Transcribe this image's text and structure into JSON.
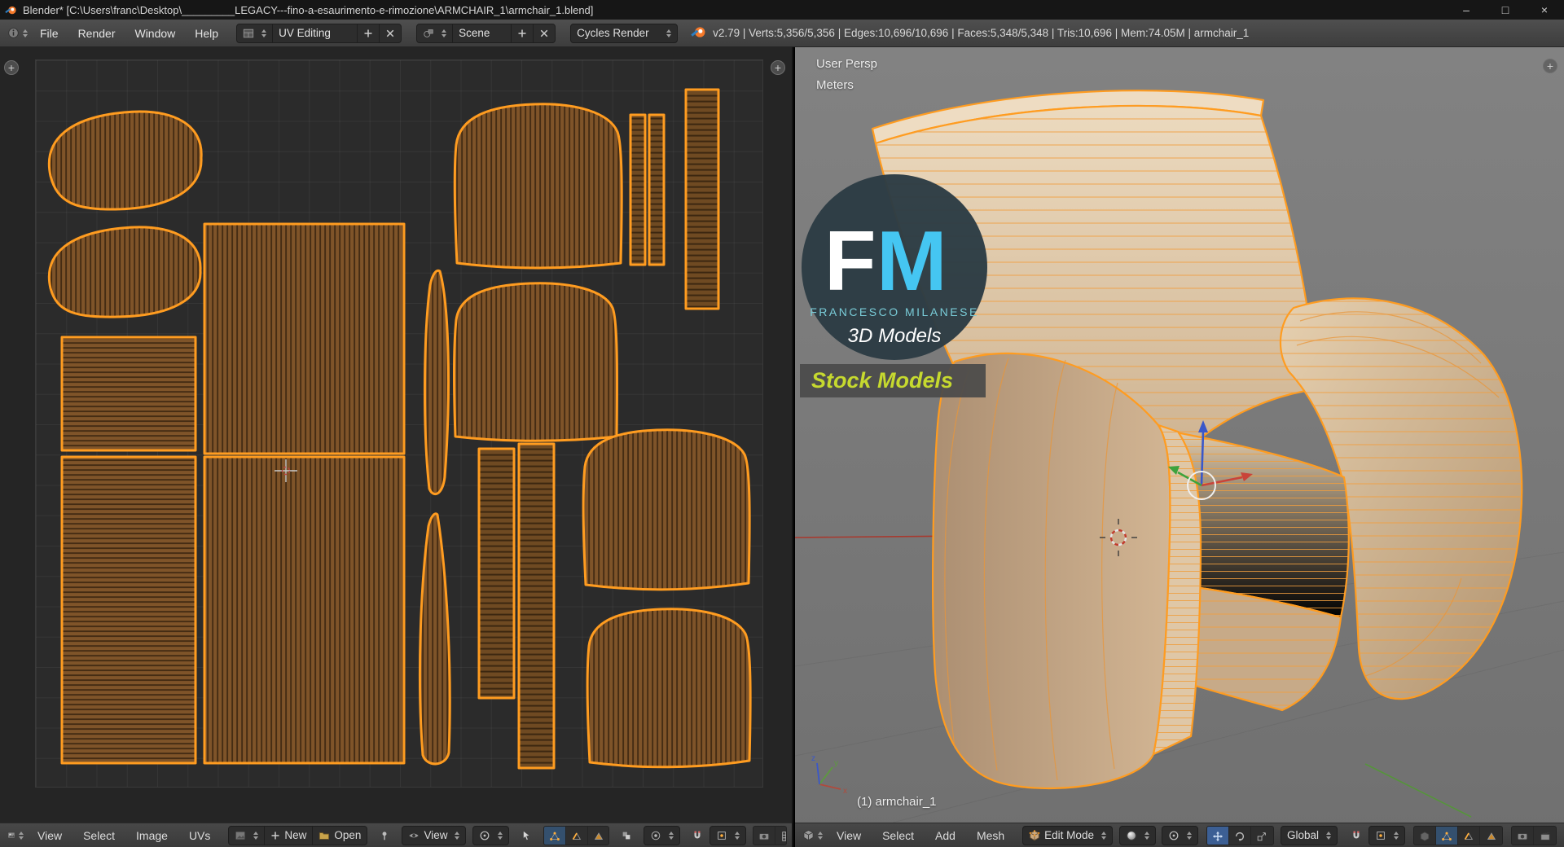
{
  "colors": {
    "selection_orange": "#ff9c20",
    "uv_island_fill": "#7f5429",
    "watermark_blue": "#45c6f2",
    "stock_green": "#c6d92f"
  },
  "icons": {
    "minimize": "–",
    "maximize": "□",
    "close": "×"
  },
  "titlebar": {
    "title": "Blender* [C:\\Users\\franc\\Desktop\\_________LEGACY---fino-a-esaurimento-e-rimozione\\ARMCHAIR_1\\armchair_1.blend]"
  },
  "info_header": {
    "menus": [
      "File",
      "Render",
      "Window",
      "Help"
    ],
    "screen_layout": "UV Editing",
    "scene": "Scene",
    "engine": "Cycles Render",
    "stats": "v2.79 | Verts:5,356/5,356 | Edges:10,696/10,696 | Faces:5,348/5,348 | Tris:10,696 | Mem:74.05M | armchair_1"
  },
  "uv_editor": {
    "menus": [
      "View",
      "Select",
      "Image",
      "UVs"
    ],
    "new_label": "New",
    "open_label": "Open",
    "mode_label": "View"
  },
  "viewport": {
    "view_label": "User Persp",
    "unit_label": "Meters",
    "object_label": "(1) armchair_1",
    "menus": [
      "View",
      "Select",
      "Add",
      "Mesh"
    ],
    "mode_label": "Edit Mode",
    "orientation_label": "Global"
  },
  "watermark": {
    "initials_f": "F",
    "initials_m": "M",
    "name": "FRANCESCO MILANESE",
    "tagline": "3D Models",
    "banner": "Stock Models"
  }
}
